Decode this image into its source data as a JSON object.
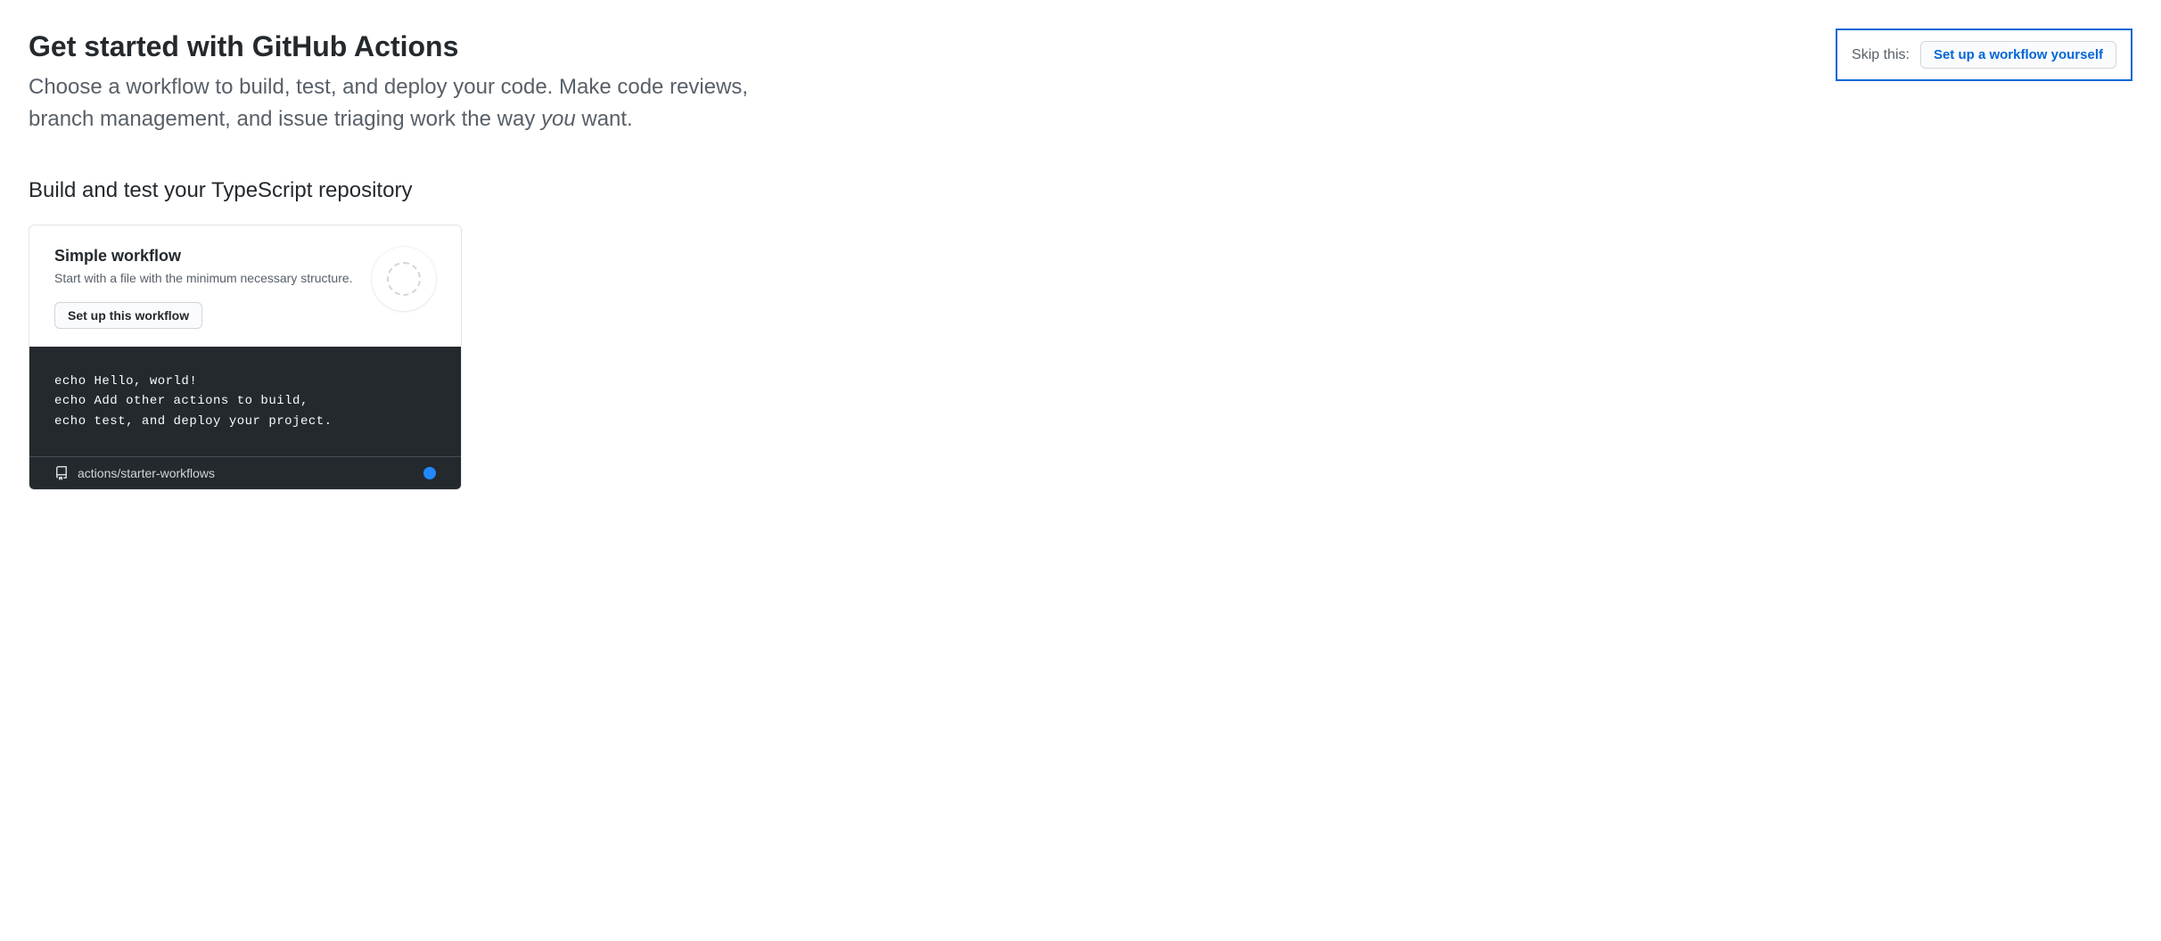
{
  "header": {
    "title": "Get started with GitHub Actions",
    "subtitle_before": "Choose a workflow to build, test, and deploy your code. Make code reviews, branch management, and issue triaging work the way ",
    "subtitle_em": "you",
    "subtitle_after": " want."
  },
  "skip": {
    "label": "Skip this:",
    "button": "Set up a workflow yourself"
  },
  "section": {
    "title": "Build and test your TypeScript repository"
  },
  "card": {
    "title": "Simple workflow",
    "description": "Start with a file with the minimum necessary structure.",
    "button": "Set up this workflow",
    "code_line1": "echo Hello, world!",
    "code_line2": "echo Add other actions to build,",
    "code_line3": "echo test, and deploy your project.",
    "repo": "actions/starter-workflows",
    "language_color": "#2188ff"
  }
}
